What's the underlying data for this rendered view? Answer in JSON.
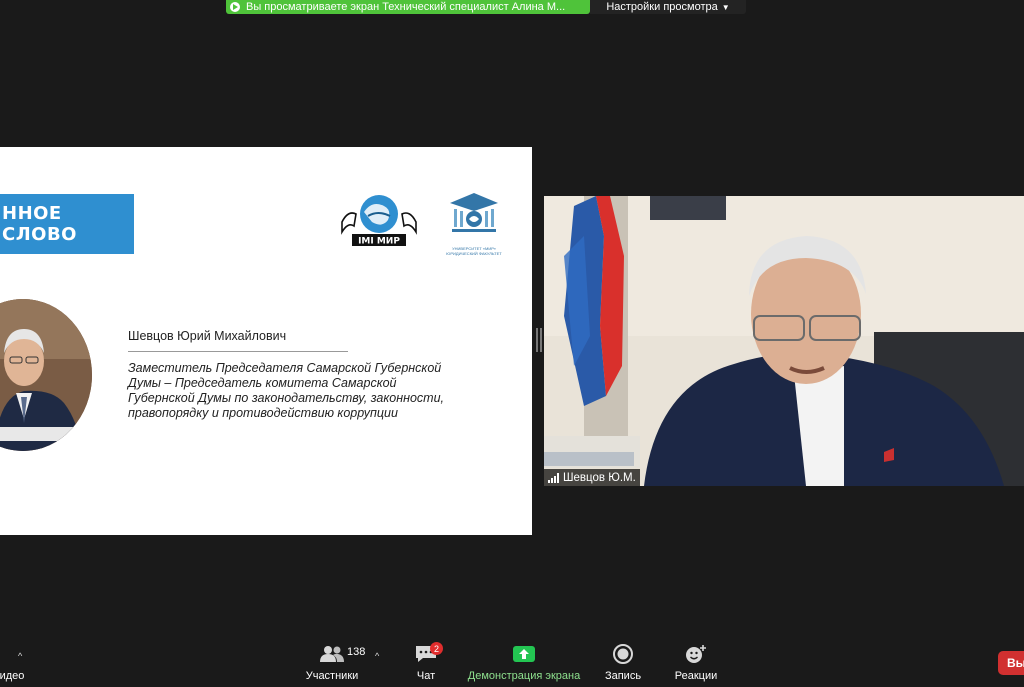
{
  "banner": {
    "sharing_text": "Вы просматриваете экран Технический специалист Алина М...",
    "view_options_label": "Настройки просмотра"
  },
  "slide": {
    "banner_text": "ННОЕ СЛОВО",
    "logo_mir_text": "IMI МИР",
    "logo_univ_caption": "УНИВЕРСИТЕТ «МИР» ЮРИДИЧЕСКИЙ ФАКУЛЬТЕТ",
    "person_name": "Шевцов Юрий Михайлович",
    "person_role": "Заместитель Председателя Самарской Губернской Думы – Председатель комитета Самарской Губернской Думы по законодательству, законности, правопорядку и противодействию коррупции"
  },
  "video": {
    "participant_name": "Шевцов Ю.М."
  },
  "toolbar": {
    "video_label": "идео",
    "participants_label": "Участники",
    "participants_count": "138",
    "chat_label": "Чат",
    "chat_badge": "2",
    "share_label": "Демонстрация экрана",
    "record_label": "Запись",
    "reactions_label": "Реакции",
    "exit_label": "Вы"
  },
  "colors": {
    "banner_green": "#4fc33a",
    "slide_banner_blue": "#2f8fd0",
    "share_icon_green": "#23c552",
    "exit_red": "#d13030"
  }
}
